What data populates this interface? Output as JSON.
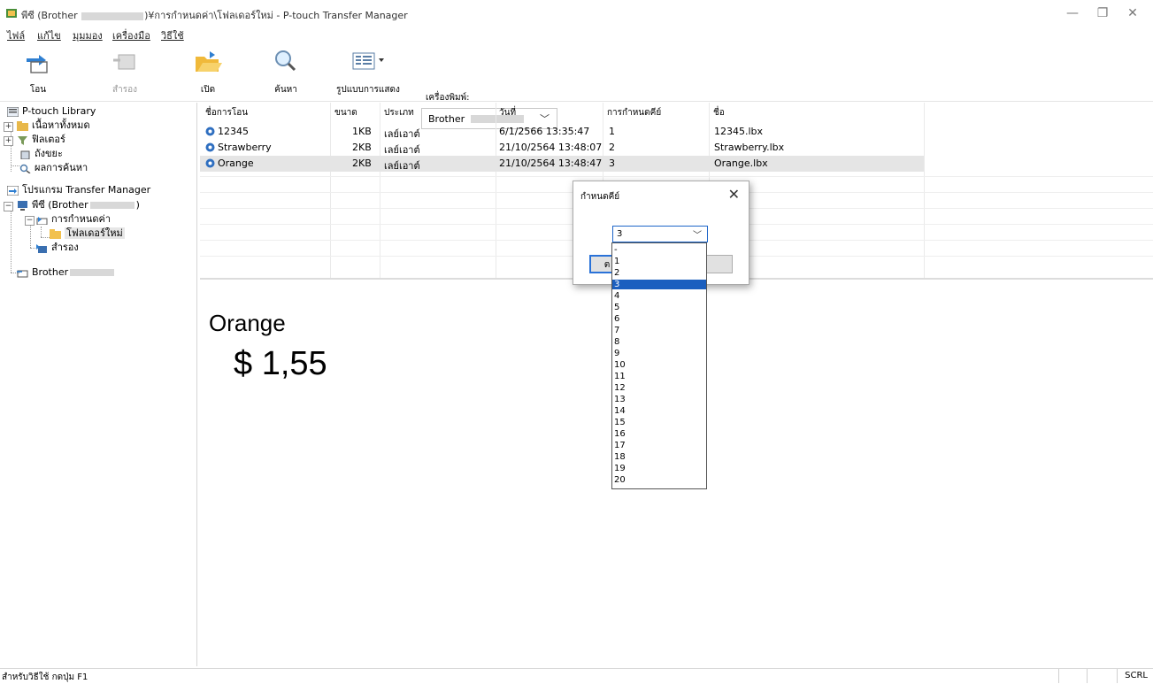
{
  "window": {
    "title_prefix": "พีซี (Brother",
    "title_suffix": ")¥การกำหนดค่า\\โฟลเดอร์ใหม่ - P-touch Transfer Manager",
    "minimize_glyph": "—",
    "restore_glyph": "❐",
    "close_glyph": "✕"
  },
  "menu": [
    "ไฟล์",
    "แก้ไข",
    "มุมมอง",
    "เครื่องมือ",
    "วิธีใช้"
  ],
  "toolbar": {
    "transfer": "โอน",
    "backup": "สำรอง",
    "open": "เปิด",
    "search": "ค้นหา",
    "view": "รูปแบบการแสดง",
    "printer_label": "เครื่องพิมพ์:",
    "printer_value": "Brother"
  },
  "tree": {
    "library": "P-touch Library",
    "all_contents": "เนื้อหาทั้งหมด",
    "filter": "ฟิลเตอร์",
    "trash": "ถังขยะ",
    "search_results": "ผลการค้นหา",
    "transfer_manager": "โปรแกรม Transfer Manager",
    "pc": "พีซี (Brother",
    "pc_close": ")",
    "config": "การกำหนดค่า",
    "new_folder": "โฟลเดอร์ใหม่",
    "backup": "สำรอง",
    "brother": "Brother"
  },
  "list": {
    "headers": {
      "transfer_name": "ชื่อการโอน",
      "size": "ขนาด",
      "type": "ประเภท",
      "date": "วันที่",
      "key": "การกำหนดคีย์",
      "name": "ชื่อ"
    },
    "rows": [
      {
        "transfer_name": "12345",
        "size": "1KB",
        "type": "เลย์เอาต์",
        "date": "6/1/2566 13:35:47",
        "key": "1",
        "name": "12345.lbx"
      },
      {
        "transfer_name": "Strawberry",
        "size": "2KB",
        "type": "เลย์เอาต์",
        "date": "21/10/2564 13:48:07",
        "key": "2",
        "name": "Strawberry.lbx"
      },
      {
        "transfer_name": "Orange",
        "size": "2KB",
        "type": "เลย์เอาต์",
        "date": "21/10/2564 13:48:47",
        "key": "3",
        "name": "Orange.lbx"
      }
    ]
  },
  "preview": {
    "name": "Orange",
    "price": "$ 1,55"
  },
  "dialog": {
    "title": "กำหนดคีย์",
    "close_glyph": "✕",
    "selected": "3",
    "ok_label": "ต",
    "cancel_label": "ก",
    "options": [
      "-",
      "1",
      "2",
      "3",
      "4",
      "5",
      "6",
      "7",
      "8",
      "9",
      "10",
      "11",
      "12",
      "13",
      "14",
      "15",
      "16",
      "17",
      "18",
      "19",
      "20"
    ]
  },
  "status": {
    "help": "สำหรับวิธีใช้ กดปุ่ม F1",
    "scrl": "SCRL"
  },
  "colors": {
    "selection_blue": "#1b5fbf",
    "focus_border": "#2a72d8"
  }
}
